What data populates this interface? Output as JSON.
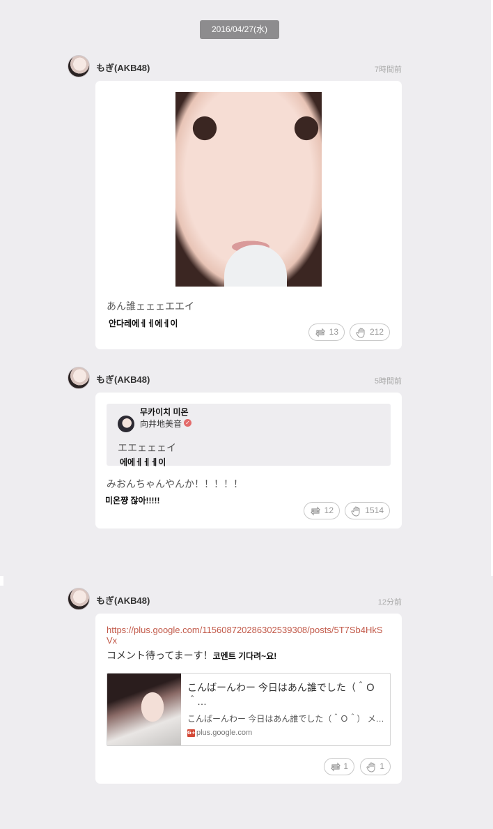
{
  "date_badge": "2016/04/27(水)",
  "posts": [
    {
      "author": "もぎ(AKB48)",
      "time": "7時間前",
      "text_jp": "あん誰ェェェエエイ",
      "text_ko": "안다레에ㅔㅔ에ㅔ이",
      "repost_count": "13",
      "like_count": "212"
    },
    {
      "author": "もぎ(AKB48)",
      "time": "5時間前",
      "quote": {
        "name_ko": "무카이치 미온",
        "name_jp": "向井地美音",
        "text_jp": "エエェェェイ",
        "text_ko": "에에ㅔㅔㅔ이"
      },
      "text_jp": "みおんちゃんやんか！！！！！",
      "text_ko": "미온쨩 잖아!!!!!",
      "repost_count": "12",
      "like_count": "1514"
    },
    {
      "author": "もぎ(AKB48)",
      "time": "12分前",
      "link": "https://plus.google.com/115608720286302539308/posts/5T7Sb4HkSVx",
      "text_jp": "コメント待ってまーす！",
      "text_ko": "코멘트 기다려~요!",
      "preview": {
        "title": "こんばーんわー 今日はあん誰でした（＾Ｏ＾…",
        "description": "こんばーんわー 今日はあん誰でした（＾Ｏ＾） メ…",
        "domain": "plus.google.com",
        "domain_icon": "G+"
      },
      "repost_count": "1",
      "like_count": "1"
    }
  ],
  "colors": {
    "background": "#eeedf0",
    "date_badge": "#8d8c8e",
    "link": "#c25a4a",
    "verified": "#e36b6b"
  }
}
